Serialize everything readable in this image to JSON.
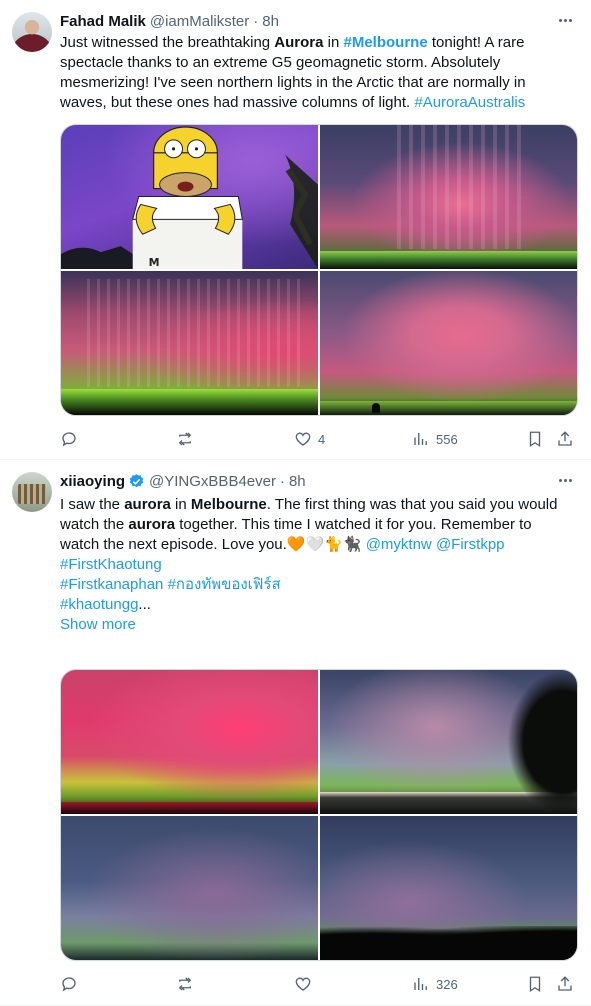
{
  "tweets": [
    {
      "name": "Fahad Malik",
      "handle": "@iamMalikster",
      "time": "8h",
      "verified": false,
      "lines": [
        [
          {
            "t": "Just witnessed the breathtaking "
          },
          {
            "t": "Aurora",
            "s": "b"
          },
          {
            "t": " in "
          },
          {
            "t": "#Melbourne",
            "s": "lb"
          },
          {
            "t": " tonight! A rare"
          }
        ],
        [
          {
            "t": "spectacle thanks to an extreme G5 geomagnetic storm. Absolutely"
          }
        ],
        [
          {
            "t": "mesmerizing! I've seen northern lights in the Arctic that are normally in"
          }
        ],
        [
          {
            "t": "waves, but these ones had massive columns of light. "
          },
          {
            "t": "#AuroraAustralis",
            "s": "l"
          }
        ]
      ],
      "stats": {
        "replies": "",
        "reposts": "",
        "likes": "4",
        "views": "556"
      }
    },
    {
      "name": "xiiaoying",
      "handle": "@YINGxBBB4ever",
      "time": "8h",
      "verified": true,
      "lines": [
        [
          {
            "t": "I saw the "
          },
          {
            "t": "aurora",
            "s": "b"
          },
          {
            "t": " in "
          },
          {
            "t": "Melbourne",
            "s": "b"
          },
          {
            "t": ". The first thing was that you said you would"
          }
        ],
        [
          {
            "t": "watch the "
          },
          {
            "t": "aurora",
            "s": "b"
          },
          {
            "t": " together. This time I watched it for you. Remember to"
          }
        ],
        [
          {
            "t": "watch the next episode. Love you.🧡🤍🐈🐈‍⬛  "
          },
          {
            "t": "@myktnw",
            "s": "l"
          },
          {
            "t": "  "
          },
          {
            "t": "@Firstkpp",
            "s": "l"
          }
        ],
        [
          {
            "t": " "
          }
        ],
        [
          {
            "t": "#FirstKhaotung",
            "s": "l"
          }
        ],
        [
          {
            "t": "#Firstkanaphan #กองทัพของเฟิร์ส",
            "s": "l"
          }
        ],
        [
          {
            "t": "#khaotungg",
            "s": "l"
          },
          {
            "t": "..."
          }
        ],
        [
          {
            "t": "Show more",
            "s": "sm"
          }
        ]
      ],
      "stats": {
        "replies": "",
        "reposts": "",
        "likes": "",
        "views": "326"
      }
    }
  ]
}
